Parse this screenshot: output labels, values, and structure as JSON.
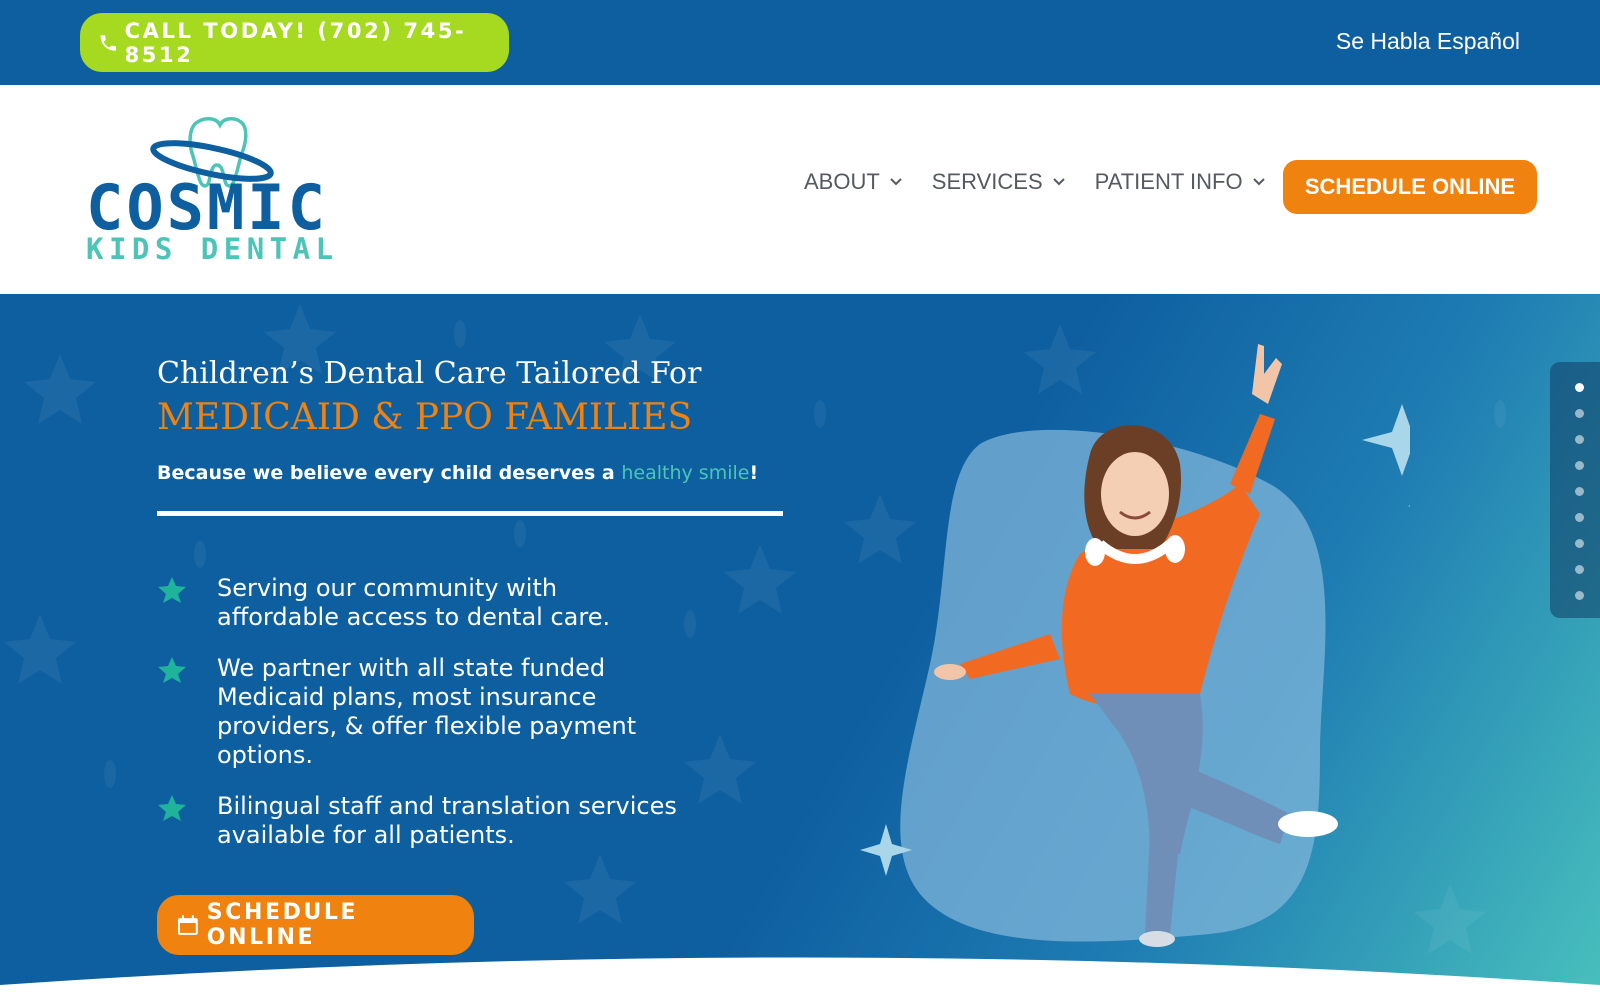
{
  "topbar": {
    "call_label": "CALL TODAY! (702) 745-8512",
    "spanish_label": "Se Habla Español"
  },
  "logo": {
    "line1": "COSMIC",
    "line2": "KIDS DENTAL"
  },
  "nav": {
    "items": [
      {
        "label": "ABOUT",
        "icon": "chevron-down-icon"
      },
      {
        "label": "SERVICES",
        "icon": "chevron-down-icon"
      },
      {
        "label": "PATIENT INFO",
        "icon": "chevron-down-icon"
      }
    ],
    "schedule_label": "SCHEDULE ONLINE"
  },
  "hero": {
    "heading_line1": "Children’s Dental Care Tailored For",
    "heading_line2": "MEDICAID & PPO FAMILIES",
    "subheading_pre": "Because we believe every child deserves a ",
    "subheading_highlight": "healthy smile",
    "subheading_post": "!",
    "bullets": [
      "Serving our community with affordable access to dental care.",
      "We partner with all state funded Medicaid plans, most insurance providers, & offer flexible payment options.",
      "Bilingual staff and translation services available for all patients."
    ],
    "cta_label": "SCHEDULE ONLINE",
    "slider": {
      "total": 9,
      "active": 1
    }
  },
  "colors": {
    "brand_blue": "#0e5fa0",
    "accent_green": "#a6da21",
    "accent_orange": "#f0820f",
    "accent_teal": "#4cc5b7"
  }
}
